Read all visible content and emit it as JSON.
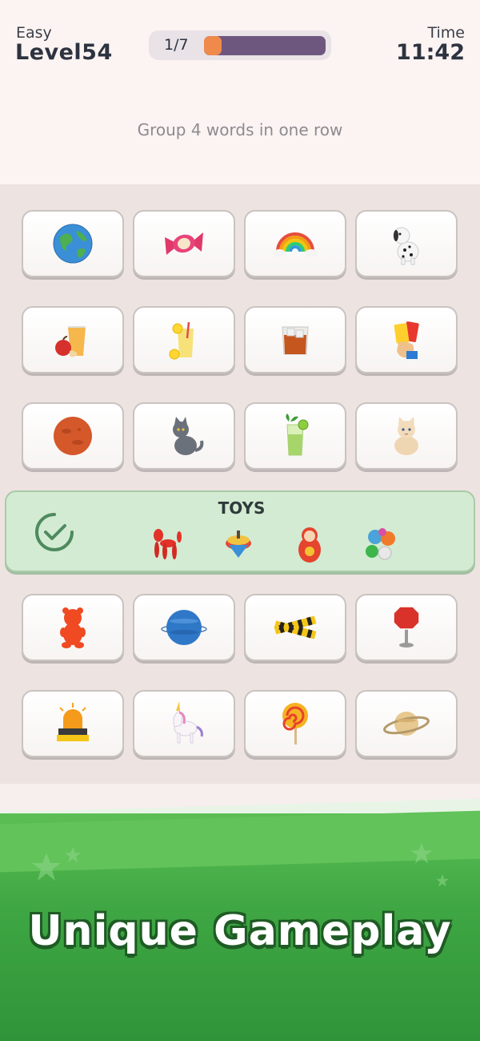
{
  "header": {
    "difficulty": "Easy",
    "level": "Level54",
    "time_label": "Time",
    "time_value": "11:42",
    "progress_text": "1/7",
    "progress_fraction": 0.143
  },
  "instruction": "Group 4 words in one row",
  "tiles": [
    [
      "earth-globe-icon",
      "candy-icon",
      "rainbow-icon",
      "dalmatian-dog-icon"
    ],
    [
      "juice-apple-icon",
      "lemonade-icon",
      "iced-drink-icon",
      "referee-cards-icon"
    ],
    [
      "mars-planet-icon",
      "gray-cat-icon",
      "mojito-icon",
      "cream-cat-icon"
    ],
    [
      "gummy-bear-icon",
      "neptune-planet-icon",
      "caution-tape-icon",
      "stop-sign-icon"
    ],
    [
      "siren-light-icon",
      "unicorn-icon",
      "lollipop-icon",
      "saturn-planet-icon"
    ]
  ],
  "solved_group": {
    "title": "TOYS",
    "items": [
      "balloon-dog-icon",
      "spinning-top-icon",
      "matryoshka-doll-icon",
      "marbles-icon"
    ]
  },
  "tagline": "Unique Gameplay",
  "colors": {
    "accent_orange": "#f08a4b",
    "progress_track": "#6e577f",
    "solved_green": "#d3ebd3",
    "banner_green": "#3fa743"
  }
}
